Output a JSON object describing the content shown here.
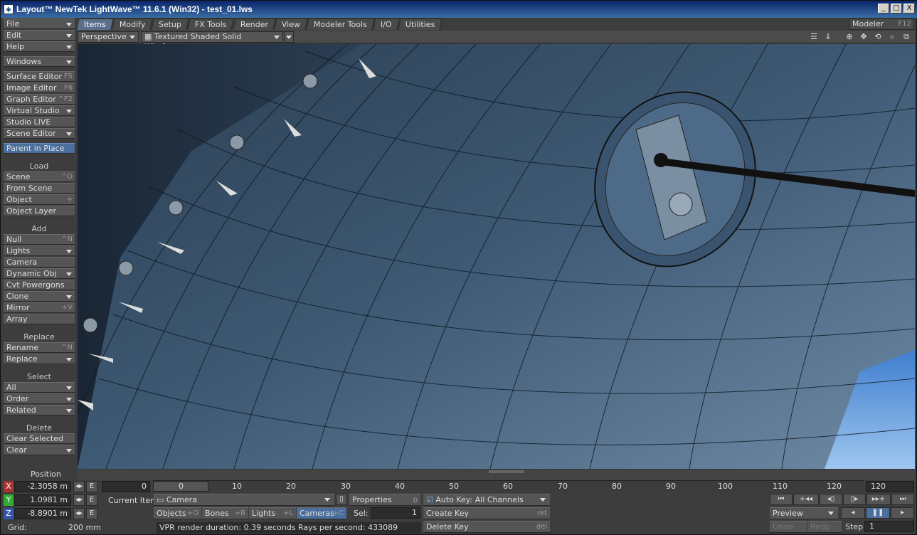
{
  "window": {
    "title": "Layout™ NewTek LightWave™ 11.6.1 (Win32) - test_01.lws",
    "buttons": [
      "_",
      "□",
      "X"
    ]
  },
  "sidebar": {
    "top": [
      {
        "label": "File",
        "dropdown": true
      },
      {
        "label": "Edit",
        "dropdown": true
      },
      {
        "label": "Help",
        "dropdown": true
      },
      {
        "label": "Windows",
        "dropdown": true
      },
      {
        "label": "Surface Editor",
        "shortcut": "F5"
      },
      {
        "label": "Image Editor",
        "shortcut": "F6"
      },
      {
        "label": "Graph Editor",
        "shortcut": "^F2"
      },
      {
        "label": "Virtual Studio",
        "dropdown": true
      },
      {
        "label": "Studio LIVE"
      },
      {
        "label": "Scene Editor",
        "dropdown": true
      },
      {
        "label": "Parent in Place",
        "selected": true
      }
    ],
    "load_header": "Load",
    "load": [
      {
        "label": "Scene",
        "shortcut": "^O"
      },
      {
        "label": "From Scene"
      },
      {
        "label": "Object",
        "shortcut": "+"
      },
      {
        "label": "Object Layer"
      }
    ],
    "add_header": "Add",
    "add": [
      {
        "label": "Null",
        "shortcut": "^N"
      },
      {
        "label": "Lights",
        "dropdown": true
      },
      {
        "label": "Camera"
      },
      {
        "label": "Dynamic Obj",
        "dropdown": true
      },
      {
        "label": "Cvt Powergons"
      },
      {
        "label": "Clone",
        "dropdown": true
      },
      {
        "label": "Mirror",
        "shortcut": "+V"
      },
      {
        "label": "Array"
      }
    ],
    "replace_header": "Replace",
    "replace": [
      {
        "label": "Rename",
        "shortcut": "^N"
      },
      {
        "label": "Replace",
        "dropdown": true
      }
    ],
    "select_header": "Select",
    "select": [
      {
        "label": "All",
        "dropdown": true
      },
      {
        "label": "Order",
        "dropdown": true
      },
      {
        "label": "Related",
        "dropdown": true
      }
    ],
    "delete_header": "Delete",
    "delete": [
      {
        "label": "Clear Selected"
      },
      {
        "label": "Clear",
        "dropdown": true
      }
    ]
  },
  "tabs": [
    "Items",
    "Modify",
    "Setup",
    "FX Tools",
    "Render",
    "View",
    "Modeler Tools",
    "I/O",
    "Utilities"
  ],
  "active_tab": "Items",
  "modeler": {
    "label": "Modeler",
    "shortcut": "F12"
  },
  "viewport": {
    "view_mode": "Perspective",
    "render_mode": "Textured Shaded Solid Wireframe"
  },
  "timeline": {
    "start": "0",
    "end": "120",
    "ticks": [
      "0",
      "10",
      "20",
      "30",
      "40",
      "50",
      "60",
      "70",
      "80",
      "90",
      "100",
      "110",
      "120"
    ],
    "current_frame": 0
  },
  "position": {
    "label": "Position",
    "x": "-2.3058 m",
    "y": "1.0981 m",
    "z": "-8.8901 m",
    "axis_x": "X",
    "axis_y": "Y",
    "axis_z": "Z",
    "env_label": "E",
    "grid_label": "Grid:",
    "grid_value": "200 mm"
  },
  "current_item": {
    "label": "Current Item",
    "value": "Camera",
    "properties": "Properties",
    "properties_shortcut": "p"
  },
  "item_types": [
    {
      "label": "Objects",
      "shortcut": "+O"
    },
    {
      "label": "Bones",
      "shortcut": "+B"
    },
    {
      "label": "Lights",
      "shortcut": "+L"
    },
    {
      "label": "Cameras",
      "shortcut": "+C",
      "active": true
    }
  ],
  "sel": {
    "label": "Sel:",
    "value": "1"
  },
  "status": "VPR render duration: 0.39 seconds  Rays per second: 433089",
  "keys": {
    "auto_key": "Auto Key: All Channels",
    "create_key": "Create Key",
    "create_key_shortcut": "ret",
    "delete_key": "Delete Key",
    "delete_key_shortcut": "del"
  },
  "transport": {
    "preview": "Preview",
    "undo": "Undo",
    "redo": "Redo",
    "step_label": "Step",
    "step_value": "1"
  }
}
